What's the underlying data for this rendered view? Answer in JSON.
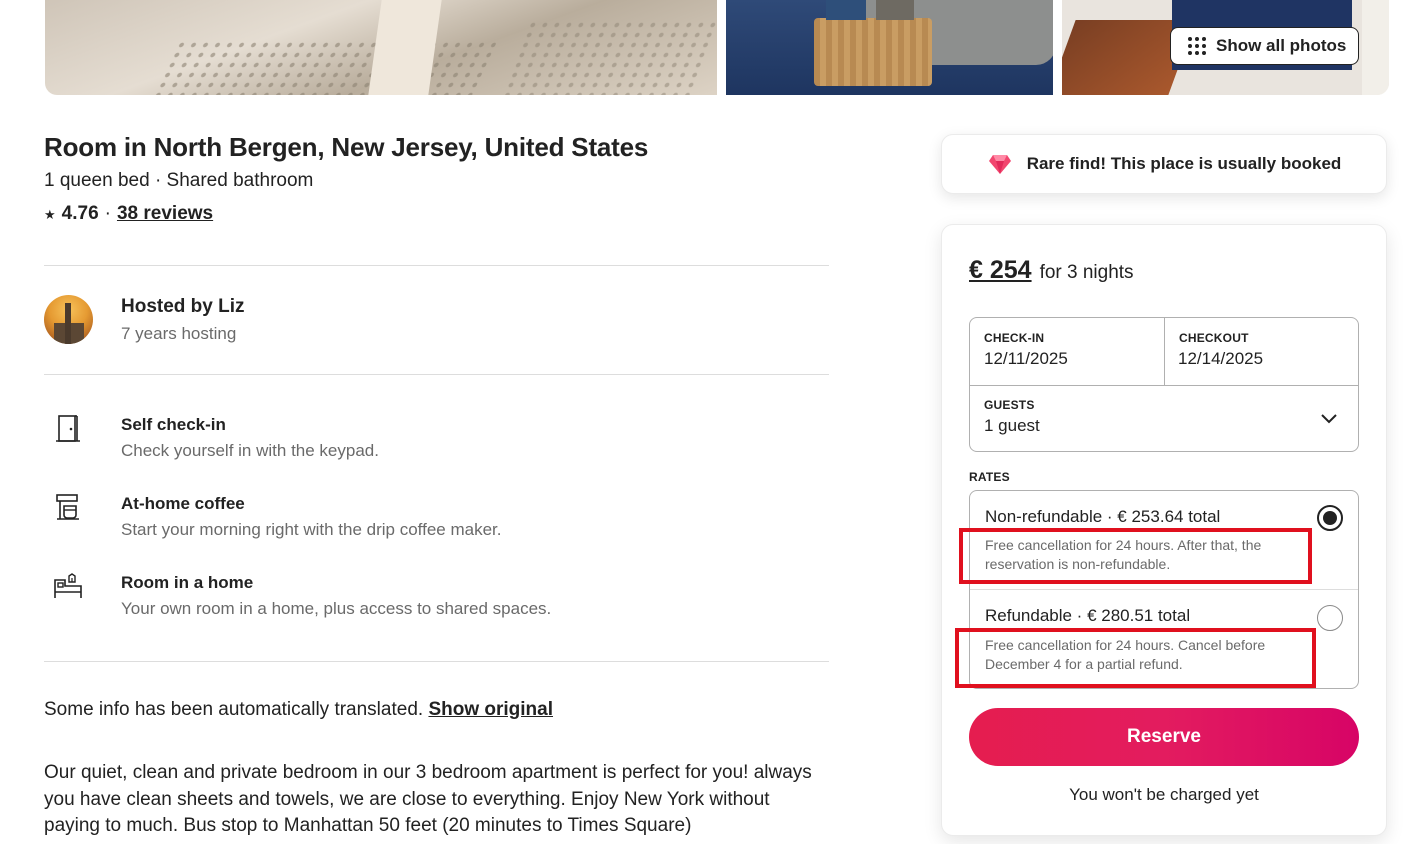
{
  "gallery": {
    "show_all_label": "Show all photos"
  },
  "listing": {
    "title": "Room in North Bergen, New Jersey, United States",
    "subtitle": "1 queen bed · Shared bathroom",
    "rating_star": "★",
    "rating": "4.76",
    "separator": "·",
    "reviews": "38 reviews"
  },
  "host": {
    "name": "Hosted by Liz",
    "years": "7 years hosting"
  },
  "features": [
    {
      "icon": "door-icon",
      "title": "Self check-in",
      "description": "Check yourself in with the keypad."
    },
    {
      "icon": "coffee-maker-icon",
      "title": "At-home coffee",
      "description": "Start your morning right with the drip coffee maker."
    },
    {
      "icon": "room-bed-icon",
      "title": "Room in a home",
      "description": "Your own room in a home, plus access to shared spaces."
    }
  ],
  "translation": {
    "note": "Some info has been automatically translated.",
    "show_original": "Show original"
  },
  "description": "Our quiet, clean and private bedroom in our 3 bedroom apartment is perfect for you! always you have clean sheets and towels, we are close to everything. Enjoy New York without paying to much. Bus stop to Manhattan 50 feet (20 minutes to Times Square)",
  "rare_find": {
    "icon": "diamond-icon",
    "text": "Rare find! This place is usually booked"
  },
  "booking": {
    "price": "€ 254",
    "price_suffix": "for 3 nights",
    "checkin_label": "CHECK-IN",
    "checkin_value": "12/11/2025",
    "checkout_label": "CHECKOUT",
    "checkout_value": "12/14/2025",
    "guests_label": "GUESTS",
    "guests_value": "1 guest",
    "rates_label": "RATES",
    "rates": [
      {
        "title": "Non-refundable · € 253.64 total",
        "description": "Free cancellation for 24 hours. After that, the reservation is non-refundable.",
        "selected": true
      },
      {
        "title": "Refundable · € 280.51 total",
        "description": "Free cancellation for 24 hours. Cancel before December 4 for a partial refund.",
        "selected": false
      }
    ],
    "reserve_label": "Reserve",
    "no_charge_note": "You won't be charged yet"
  },
  "colors": {
    "brand": "#e31c5f",
    "highlight": "#e0101e",
    "text": "#222222",
    "muted": "#6a6a6a"
  }
}
